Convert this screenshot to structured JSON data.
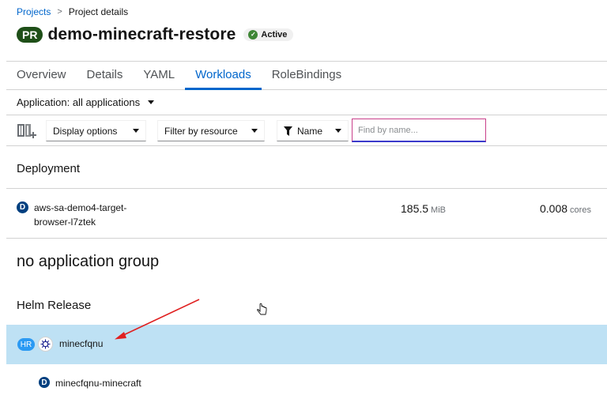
{
  "breadcrumb": {
    "link": "Projects",
    "separator": ">",
    "current": "Project details"
  },
  "project": {
    "badge": "PR",
    "name": "demo-minecraft-restore",
    "status": "Active"
  },
  "tabs": [
    {
      "label": "Overview",
      "active": false
    },
    {
      "label": "Details",
      "active": false
    },
    {
      "label": "YAML",
      "active": false
    },
    {
      "label": "Workloads",
      "active": true
    },
    {
      "label": "RoleBindings",
      "active": false
    }
  ],
  "application_filter": {
    "label": "Application: all applications"
  },
  "toolbar": {
    "display_options": "Display options",
    "filter_by_resource": "Filter by resource",
    "name_filter": "Name",
    "search_placeholder": "Find by name..."
  },
  "deployment_section": {
    "title": "Deployment",
    "item": {
      "badge": "D",
      "name": "aws-sa-demo4-target-browser-l7ztek",
      "memory_value": "185.5",
      "memory_unit": "MiB",
      "cpu_value": "0.008",
      "cpu_unit": "cores"
    }
  },
  "group": {
    "title": "no application group"
  },
  "helm_section": {
    "title": "Helm Release",
    "release": {
      "badge": "HR",
      "icon": "helm-icon",
      "name": "minecfqnu"
    },
    "child": {
      "badge": "D",
      "name": "minecfqnu-minecraft"
    }
  },
  "colors": {
    "link": "#0066cc",
    "active_tab": "#0066cc",
    "project_badge": "#1e4f18",
    "status_ok": "#3e8635",
    "selected_row": "#bee1f4",
    "hr_badge": "#2b9af3",
    "deployment_badge": "#004080",
    "annotation_arrow": "#e02020"
  }
}
